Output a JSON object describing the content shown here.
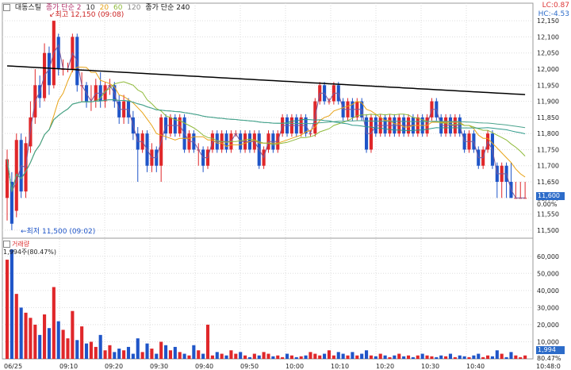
{
  "legend": {
    "name": "대동스틸",
    "ma_label": "종가 단순 2",
    "ma_periods": [
      "10",
      "20",
      "60",
      "120"
    ],
    "ma2_label": "종가 단순 240"
  },
  "corner": {
    "lc": "LC:0.87",
    "hc": "HC:-4.53"
  },
  "price_axis": {
    "ticks": [
      "12,150",
      "12,100",
      "12,050",
      "12,000",
      "11,950",
      "11,900",
      "11,850",
      "11,800",
      "11,750",
      "11,700",
      "11,650",
      "11,600",
      "11,550",
      "11,500"
    ]
  },
  "last": {
    "price": "11,600",
    "pct": "0.00%"
  },
  "volume": {
    "title": "거래량",
    "legend": "1,994주(80.47%)",
    "ticks": [
      "60,000",
      "50,000",
      "40,000",
      "30,000",
      "20,000",
      "10,000"
    ],
    "last": "1,994",
    "pct": "80.47%"
  },
  "annotations": {
    "high": "최고 12,150 (09:08)",
    "low": "최저 11,500 (09:02)"
  },
  "time_axis": {
    "labels": [
      "06/25",
      "09:10",
      "09:20",
      "09:30",
      "09:40",
      "09:50",
      "10:00",
      "10:10",
      "10:20",
      "10:30",
      "10:40",
      "10:48:0"
    ]
  },
  "colors": {
    "up": "#e0272a",
    "down": "#1f55c8",
    "ma2": "#7a5b9c",
    "ma10": "#e8a317",
    "ma20": "#8fba3a",
    "ma60": "#2d9a8a",
    "ma120": "#4aa38c",
    "ma240": "#000000"
  },
  "chart_data": {
    "type": "candlestick",
    "y_axis": {
      "min": 11475,
      "max": 12180
    },
    "volume_axis": {
      "min": 0,
      "max": 65000
    },
    "candles": [
      {
        "o": 11600,
        "c": 11720,
        "h": 11750,
        "l": 11530
      },
      {
        "o": 11650,
        "c": 11520,
        "h": 11680,
        "l": 11500
      },
      {
        "o": 11560,
        "c": 11780,
        "h": 11800,
        "l": 11540
      },
      {
        "o": 11780,
        "c": 11620,
        "h": 11800,
        "l": 11600
      },
      {
        "o": 11620,
        "c": 11770,
        "h": 11790,
        "l": 11600
      },
      {
        "o": 11760,
        "c": 11850,
        "h": 11900,
        "l": 11740
      },
      {
        "o": 11850,
        "c": 11950,
        "h": 12000,
        "l": 11830
      },
      {
        "o": 11950,
        "c": 11910,
        "h": 11980,
        "l": 11880
      },
      {
        "o": 11910,
        "c": 12050,
        "h": 12080,
        "l": 11900
      },
      {
        "o": 12050,
        "c": 11950,
        "h": 12070,
        "l": 11920
      },
      {
        "o": 11950,
        "c": 12150,
        "h": 12150,
        "l": 11940
      },
      {
        "o": 12100,
        "c": 12000,
        "h": 12110,
        "l": 11980
      },
      {
        "o": 12000,
        "c": 12000,
        "h": 12030,
        "l": 11980
      },
      {
        "o": 12000,
        "c": 12000,
        "h": 12020,
        "l": 11990
      },
      {
        "o": 12000,
        "c": 12100,
        "h": 12110,
        "l": 11990
      },
      {
        "o": 12100,
        "c": 11950,
        "h": 12110,
        "l": 11930
      },
      {
        "o": 11950,
        "c": 11950,
        "h": 11990,
        "l": 11900
      },
      {
        "o": 11950,
        "c": 11900,
        "h": 11960,
        "l": 11880
      },
      {
        "o": 11900,
        "c": 11900,
        "h": 11950,
        "l": 11870
      },
      {
        "o": 11900,
        "c": 11950,
        "h": 11970,
        "l": 11880
      },
      {
        "o": 11950,
        "c": 11900,
        "h": 11990,
        "l": 11880
      },
      {
        "o": 11900,
        "c": 11950,
        "h": 11960,
        "l": 11880
      },
      {
        "o": 11950,
        "c": 11950,
        "h": 11970,
        "l": 11920
      },
      {
        "o": 11950,
        "c": 11900,
        "h": 11960,
        "l": 11880
      },
      {
        "o": 11900,
        "c": 11850,
        "h": 11920,
        "l": 11830
      },
      {
        "o": 11850,
        "c": 11900,
        "h": 11920,
        "l": 11830
      },
      {
        "o": 11900,
        "c": 11850,
        "h": 11910,
        "l": 11830
      },
      {
        "o": 11850,
        "c": 11800,
        "h": 11870,
        "l": 11780
      },
      {
        "o": 11800,
        "c": 11750,
        "h": 11820,
        "l": 11650
      },
      {
        "o": 11750,
        "c": 11800,
        "h": 11810,
        "l": 11740
      },
      {
        "o": 11800,
        "c": 11700,
        "h": 11810,
        "l": 11680
      },
      {
        "o": 11700,
        "c": 11750,
        "h": 11770,
        "l": 11680
      },
      {
        "o": 11750,
        "c": 11700,
        "h": 11760,
        "l": 11680
      },
      {
        "o": 11700,
        "c": 11850,
        "h": 11860,
        "l": 11650
      },
      {
        "o": 11850,
        "c": 11800,
        "h": 11860,
        "l": 11780
      },
      {
        "o": 11800,
        "c": 11850,
        "h": 11860,
        "l": 11790
      },
      {
        "o": 11850,
        "c": 11800,
        "h": 11860,
        "l": 11790
      },
      {
        "o": 11800,
        "c": 11850,
        "h": 11860,
        "l": 11790
      },
      {
        "o": 11850,
        "c": 11750,
        "h": 11860,
        "l": 11740
      },
      {
        "o": 11750,
        "c": 11800,
        "h": 11810,
        "l": 11740
      },
      {
        "o": 11800,
        "c": 11750,
        "h": 11810,
        "l": 11740
      },
      {
        "o": 11750,
        "c": 11750,
        "h": 11770,
        "l": 11700
      },
      {
        "o": 11750,
        "c": 11700,
        "h": 11760,
        "l": 11680
      },
      {
        "o": 11700,
        "c": 11750,
        "h": 11760,
        "l": 11690
      },
      {
        "o": 11750,
        "c": 11800,
        "h": 11810,
        "l": 11740
      },
      {
        "o": 11800,
        "c": 11750,
        "h": 11810,
        "l": 11740
      },
      {
        "o": 11750,
        "c": 11800,
        "h": 11810,
        "l": 11740
      },
      {
        "o": 11800,
        "c": 11750,
        "h": 11810,
        "l": 11740
      },
      {
        "o": 11750,
        "c": 11800,
        "h": 11810,
        "l": 11740
      },
      {
        "o": 11800,
        "c": 11800,
        "h": 11810,
        "l": 11790
      },
      {
        "o": 11800,
        "c": 11750,
        "h": 11810,
        "l": 11740
      },
      {
        "o": 11750,
        "c": 11800,
        "h": 11810,
        "l": 11740
      },
      {
        "o": 11800,
        "c": 11750,
        "h": 11810,
        "l": 11740
      },
      {
        "o": 11750,
        "c": 11800,
        "h": 11810,
        "l": 11740
      },
      {
        "o": 11800,
        "c": 11700,
        "h": 11810,
        "l": 11690
      },
      {
        "o": 11700,
        "c": 11750,
        "h": 11760,
        "l": 11690
      },
      {
        "o": 11750,
        "c": 11800,
        "h": 11810,
        "l": 11740
      },
      {
        "o": 11800,
        "c": 11750,
        "h": 11810,
        "l": 11740
      },
      {
        "o": 11750,
        "c": 11800,
        "h": 11810,
        "l": 11740
      },
      {
        "o": 11800,
        "c": 11850,
        "h": 11860,
        "l": 11790
      },
      {
        "o": 11850,
        "c": 11800,
        "h": 11860,
        "l": 11790
      },
      {
        "o": 11800,
        "c": 11850,
        "h": 11860,
        "l": 11790
      },
      {
        "o": 11850,
        "c": 11800,
        "h": 11860,
        "l": 11790
      },
      {
        "o": 11800,
        "c": 11850,
        "h": 11860,
        "l": 11790
      },
      {
        "o": 11850,
        "c": 11800,
        "h": 11860,
        "l": 11790
      },
      {
        "o": 11800,
        "c": 11800,
        "h": 11810,
        "l": 11790
      },
      {
        "o": 11800,
        "c": 11900,
        "h": 11910,
        "l": 11790
      },
      {
        "o": 11900,
        "c": 11950,
        "h": 11960,
        "l": 11890
      },
      {
        "o": 11950,
        "c": 11900,
        "h": 11960,
        "l": 11890
      },
      {
        "o": 11900,
        "c": 11900,
        "h": 11910,
        "l": 11890
      },
      {
        "o": 11900,
        "c": 11950,
        "h": 11960,
        "l": 11890
      },
      {
        "o": 11950,
        "c": 11900,
        "h": 11960,
        "l": 11890
      },
      {
        "o": 11900,
        "c": 11850,
        "h": 11910,
        "l": 11840
      },
      {
        "o": 11850,
        "c": 11900,
        "h": 11910,
        "l": 11840
      },
      {
        "o": 11900,
        "c": 11850,
        "h": 11910,
        "l": 11840
      },
      {
        "o": 11850,
        "c": 11900,
        "h": 11910,
        "l": 11840
      },
      {
        "o": 11900,
        "c": 11850,
        "h": 11910,
        "l": 11840
      },
      {
        "o": 11850,
        "c": 11750,
        "h": 11860,
        "l": 11740
      },
      {
        "o": 11750,
        "c": 11850,
        "h": 11860,
        "l": 11740
      },
      {
        "o": 11850,
        "c": 11800,
        "h": 11860,
        "l": 11790
      },
      {
        "o": 11800,
        "c": 11850,
        "h": 11860,
        "l": 11790
      },
      {
        "o": 11850,
        "c": 11800,
        "h": 11860,
        "l": 11790
      },
      {
        "o": 11800,
        "c": 11850,
        "h": 11860,
        "l": 11790
      },
      {
        "o": 11850,
        "c": 11800,
        "h": 11860,
        "l": 11790
      },
      {
        "o": 11800,
        "c": 11850,
        "h": 11860,
        "l": 11790
      },
      {
        "o": 11850,
        "c": 11800,
        "h": 11860,
        "l": 11790
      },
      {
        "o": 11800,
        "c": 11850,
        "h": 11860,
        "l": 11790
      },
      {
        "o": 11850,
        "c": 11800,
        "h": 11860,
        "l": 11790
      },
      {
        "o": 11800,
        "c": 11850,
        "h": 11860,
        "l": 11790
      },
      {
        "o": 11850,
        "c": 11800,
        "h": 11860,
        "l": 11790
      },
      {
        "o": 11800,
        "c": 11850,
        "h": 11860,
        "l": 11790
      },
      {
        "o": 11850,
        "c": 11900,
        "h": 11910,
        "l": 11840
      },
      {
        "o": 11900,
        "c": 11850,
        "h": 11910,
        "l": 11840
      },
      {
        "o": 11850,
        "c": 11800,
        "h": 11860,
        "l": 11790
      },
      {
        "o": 11800,
        "c": 11850,
        "h": 11860,
        "l": 11790
      },
      {
        "o": 11850,
        "c": 11800,
        "h": 11860,
        "l": 11790
      },
      {
        "o": 11800,
        "c": 11850,
        "h": 11860,
        "l": 11790
      },
      {
        "o": 11850,
        "c": 11800,
        "h": 11860,
        "l": 11790
      },
      {
        "o": 11800,
        "c": 11750,
        "h": 11810,
        "l": 11740
      },
      {
        "o": 11750,
        "c": 11800,
        "h": 11810,
        "l": 11740
      },
      {
        "o": 11800,
        "c": 11750,
        "h": 11810,
        "l": 11740
      },
      {
        "o": 11750,
        "c": 11700,
        "h": 11760,
        "l": 11690
      },
      {
        "o": 11700,
        "c": 11750,
        "h": 11760,
        "l": 11690
      },
      {
        "o": 11750,
        "c": 11800,
        "h": 11810,
        "l": 11740
      },
      {
        "o": 11800,
        "c": 11700,
        "h": 11810,
        "l": 11690
      },
      {
        "o": 11700,
        "c": 11650,
        "h": 11710,
        "l": 11600
      },
      {
        "o": 11650,
        "c": 11700,
        "h": 11710,
        "l": 11600
      },
      {
        "o": 11700,
        "c": 11650,
        "h": 11710,
        "l": 11600
      },
      {
        "o": 11650,
        "c": 11600,
        "h": 11710,
        "l": 11600
      },
      {
        "o": 11600,
        "c": 11600,
        "h": 11650,
        "l": 11600
      },
      {
        "o": 11600,
        "c": 11600,
        "h": 11650,
        "l": 11600
      },
      {
        "o": 11600,
        "c": 11600,
        "h": 11650,
        "l": 11600
      }
    ],
    "volumes": [
      58000,
      64000,
      38000,
      30000,
      27000,
      24000,
      20000,
      14000,
      26000,
      18000,
      42000,
      22000,
      17000,
      12000,
      28000,
      11000,
      19000,
      9000,
      10000,
      7000,
      14000,
      5000,
      8000,
      4000,
      6000,
      5000,
      7000,
      3000,
      12000,
      4000,
      9000,
      6000,
      3000,
      10000,
      8000,
      5000,
      7000,
      4000,
      3000,
      2000,
      8000,
      5000,
      3000,
      20000,
      2000,
      4000,
      3000,
      2000,
      5000,
      3000,
      4000,
      2000,
      1000,
      3000,
      2000,
      4000,
      3000,
      1500,
      2000,
      1000,
      3000,
      2000,
      1000,
      1500,
      2000,
      4000,
      3000,
      2000,
      3000,
      5000,
      2000,
      4000,
      3000,
      2000,
      4000,
      2000,
      3000,
      5000,
      2000,
      1500,
      3000,
      2000,
      1000,
      2000,
      3000,
      1500,
      2000,
      1000,
      2000,
      3000,
      2000,
      1500,
      1000,
      2000,
      1500,
      3000,
      1000,
      2000,
      1500,
      1000,
      2000,
      3000,
      1000,
      2000,
      1500,
      5000,
      3000,
      1000,
      4000,
      2000,
      1000,
      1994
    ]
  }
}
